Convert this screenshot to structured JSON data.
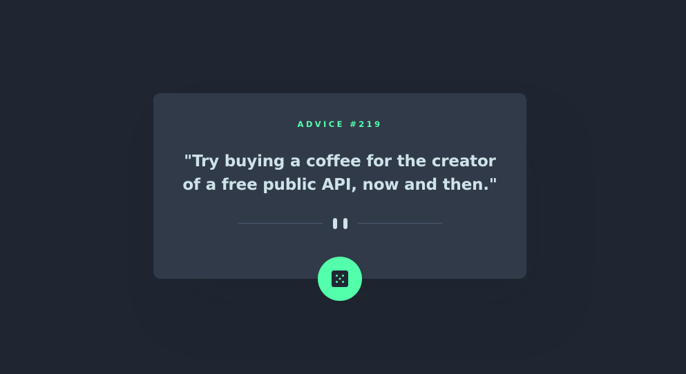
{
  "advice": {
    "label": "ADVICE #219",
    "quote": "\"Try buying a coffee for the creator of a free public API, now and then.\""
  },
  "icons": {
    "divider": "pause-icon",
    "button": "dice-icon"
  },
  "colors": {
    "background": "#1f2631",
    "card": "#313a49",
    "accent": "#53ffaa",
    "text": "#cee3e9",
    "divider": "#4f5d74"
  }
}
